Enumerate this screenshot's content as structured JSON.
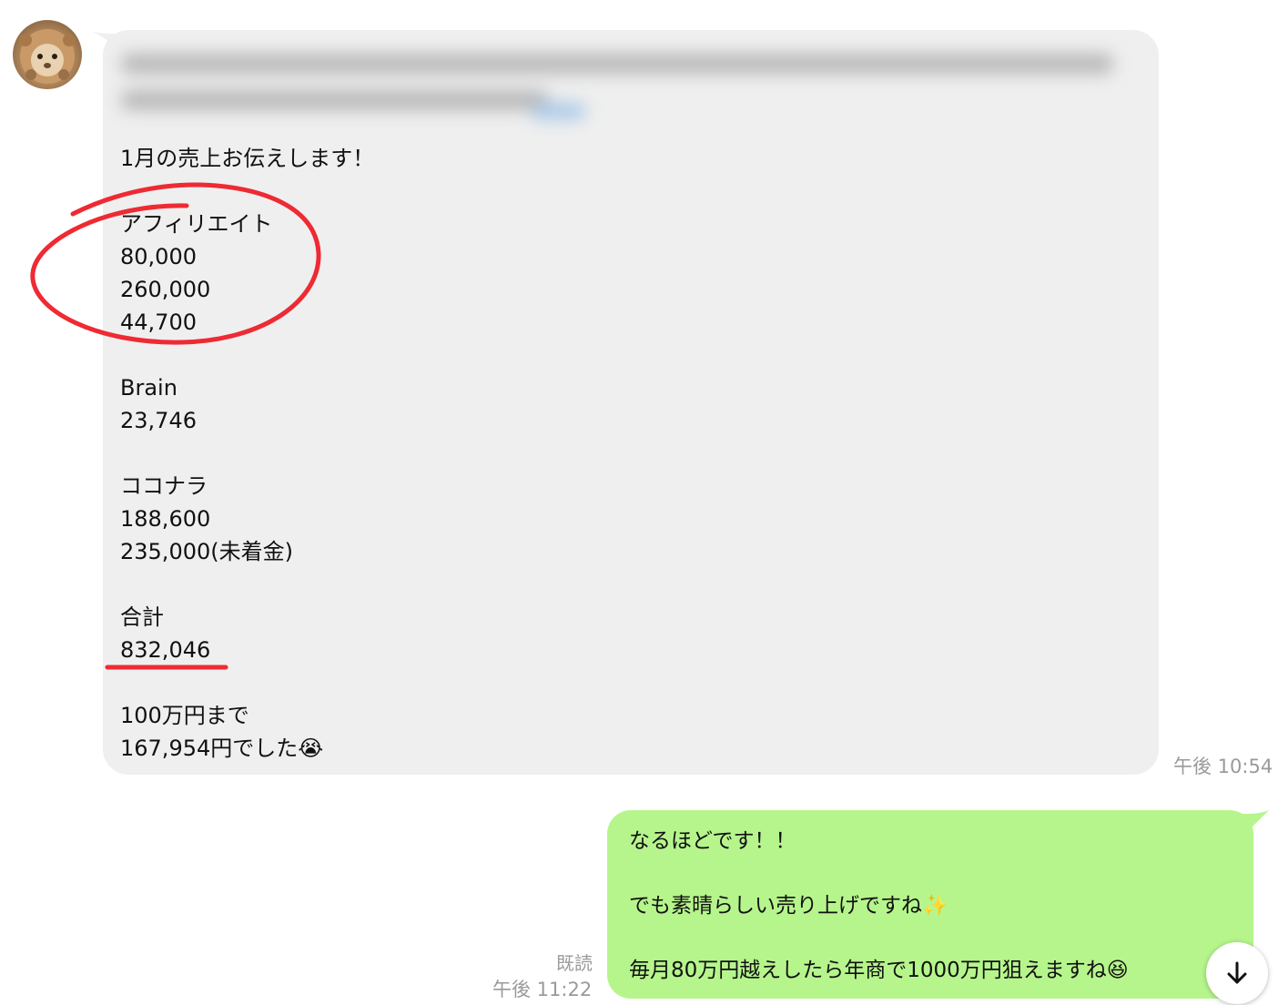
{
  "received_message": {
    "intro": "1月の売上お伝えします！",
    "affiliate_label": "アフィリエイト",
    "affiliate_amounts": [
      "80,000",
      "260,000",
      "44,700"
    ],
    "brain_label": "Brain",
    "brain_amount": "23,746",
    "coconala_label": "ココナラ",
    "coconala_amounts": [
      "188,600",
      "235,000(未着金)"
    ],
    "total_label": "合計",
    "total_amount": "832,046",
    "remaining_line1": "100万円まで",
    "remaining_line2": "167,954円でした😭",
    "time": "午後 10:54"
  },
  "sent_message": {
    "line1": "なるほどです！！",
    "line2": "でも素晴らしい売り上げですね✨",
    "line3": "毎月80万円越えしたら年商で1000万円狙えますね😆",
    "read_status": "既読",
    "time": "午後 11:22"
  },
  "colors": {
    "received_bubble": "#efefef",
    "sent_bubble": "#b6f58c",
    "annotation_red": "#ee2a33",
    "timestamp_gray": "#9a9a9a"
  },
  "icons": {
    "scroll_down": "arrow-down-icon",
    "avatar": "avatar-image"
  }
}
